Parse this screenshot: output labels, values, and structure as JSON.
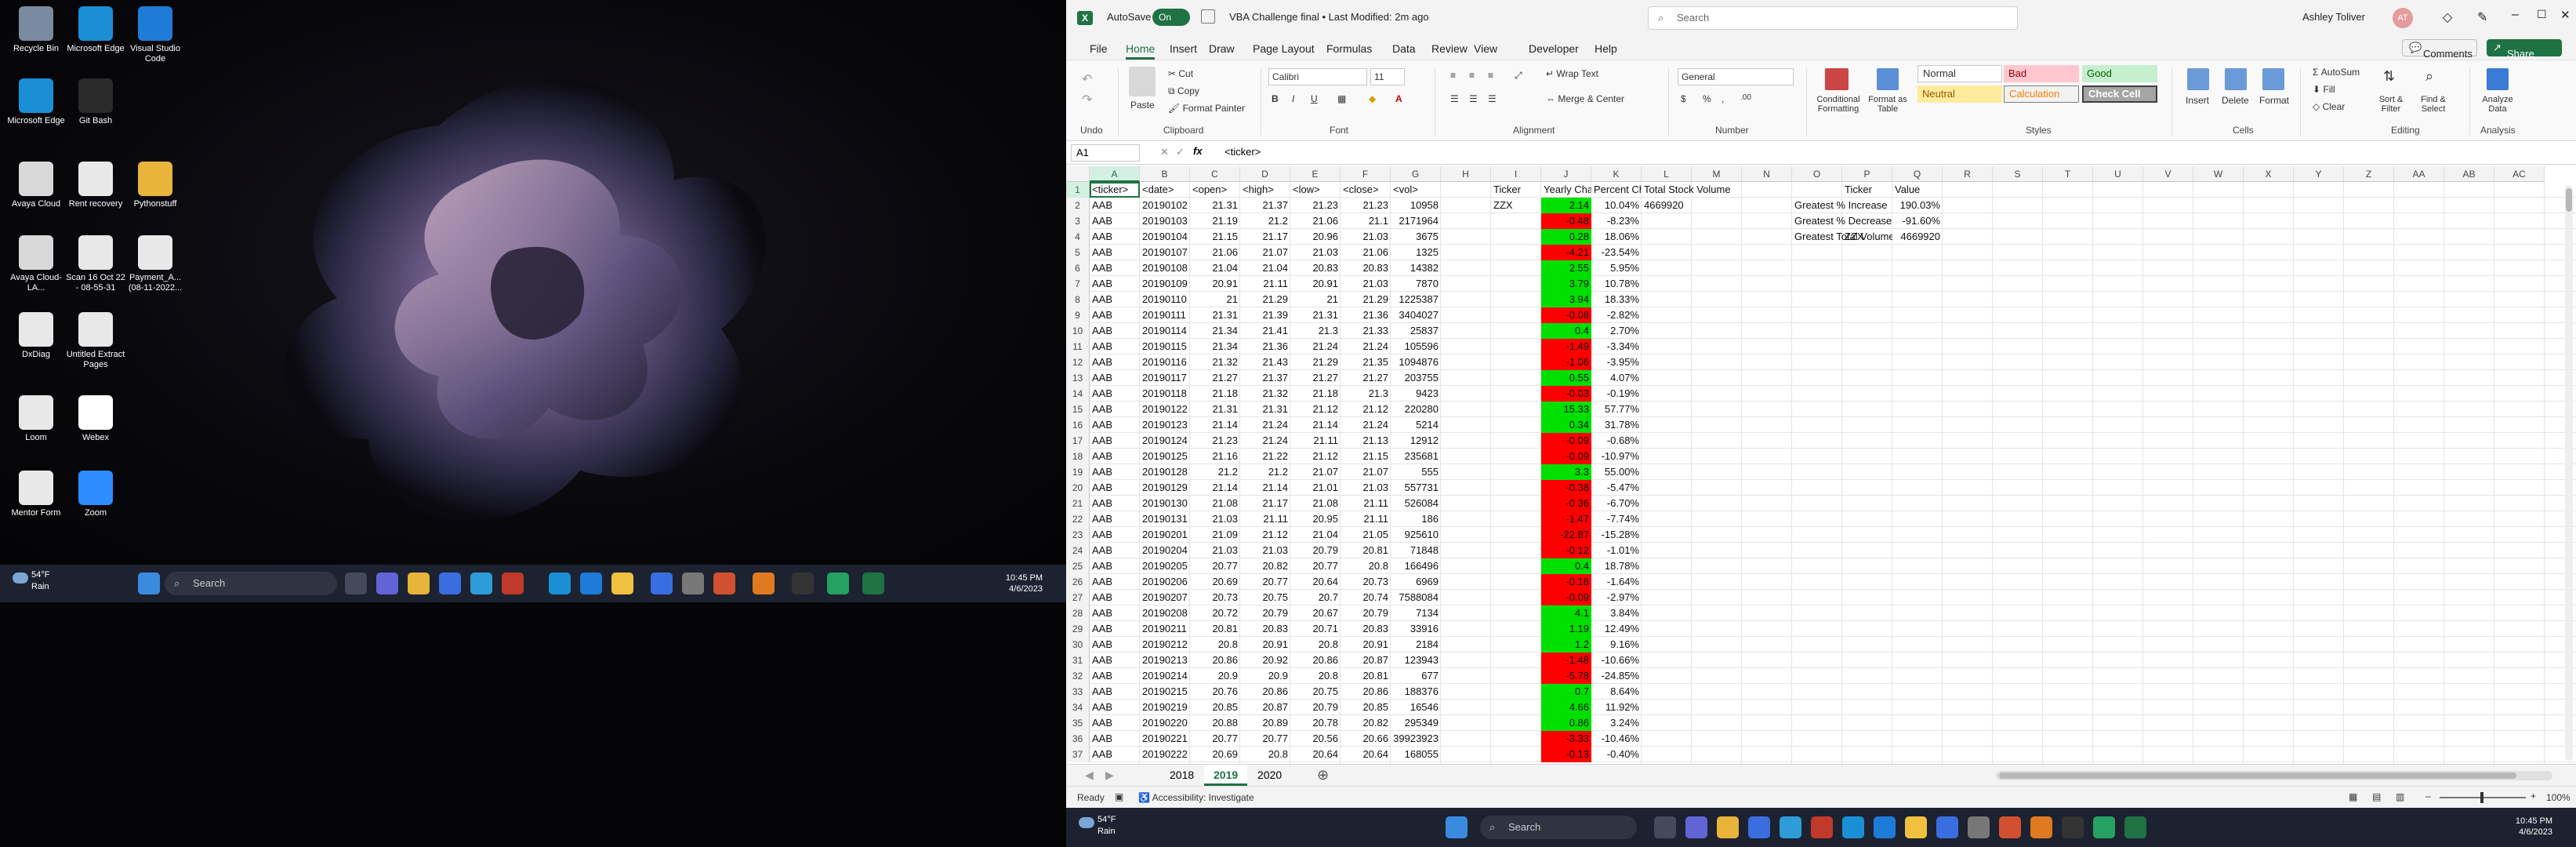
{
  "desktop": {
    "icons": [
      {
        "label": "Recycle Bin",
        "name": "recycle-bin-icon",
        "color": "#7a8aa0"
      },
      {
        "label": "Microsoft Edge",
        "name": "edge-icon",
        "color": "#1a8fd6"
      },
      {
        "label": "Visual Studio Code",
        "name": "vscode-icon",
        "color": "#1f7bd8"
      },
      {
        "label": "Microsoft Edge",
        "name": "edge-icon",
        "color": "#1a8fd6"
      },
      {
        "label": "Git Bash",
        "name": "git-bash-icon",
        "color": "#2a2a2a"
      },
      {
        "label": "Avaya Cloud",
        "name": "avaya-icon",
        "color": "#d9d9d9"
      },
      {
        "label": "Rent recovery",
        "name": "document-icon",
        "color": "#e8e8e8"
      },
      {
        "label": "Pythonstuff",
        "name": "folder-icon",
        "color": "#e8b43a"
      },
      {
        "label": "Avaya Cloud-LA...",
        "name": "avaya-icon",
        "color": "#d9d9d9"
      },
      {
        "label": "Scan 16 Oct 22 - 08-55-31",
        "name": "document-icon",
        "color": "#e8e8e8"
      },
      {
        "label": "Payment_A... (08-11-2022...",
        "name": "document-icon",
        "color": "#e8e8e8"
      },
      {
        "label": "DxDiag",
        "name": "document-icon",
        "color": "#e8e8e8"
      },
      {
        "label": "Untitled Extract Pages",
        "name": "document-icon",
        "color": "#e8e8e8"
      },
      {
        "label": "Loom",
        "name": "loom-icon",
        "color": "#e8e8e8"
      },
      {
        "label": "Webex",
        "name": "document-icon",
        "color": "#ffffff"
      },
      {
        "label": "Mentor Form",
        "name": "document-icon",
        "color": "#e8e8e8"
      },
      {
        "label": "Zoom",
        "name": "zoom-icon",
        "color": "#2d8cff"
      }
    ],
    "taskbar": {
      "weather_temp": "54°F",
      "weather_desc": "Rain",
      "search": "Search",
      "time": "10:45 PM",
      "date": "4/6/2023"
    }
  },
  "excel": {
    "autosave_label": "AutoSave",
    "autosave_state": "On",
    "doc_title": "VBA Challenge final • Last Modified: 2m ago",
    "search_placeholder": "Search",
    "user_name": "Ashley Toliver",
    "user_initials": "AT",
    "menu": [
      "File",
      "Home",
      "Insert",
      "Draw",
      "Page Layout",
      "Formulas",
      "Data",
      "Review",
      "View",
      "Developer",
      "Help"
    ],
    "comments": "Comments",
    "share": "Share",
    "ribbon": {
      "undo": "Undo",
      "paste": "Paste",
      "cut": "Cut",
      "copy": "Copy",
      "format_painter": "Format Painter",
      "clipboard": "Clipboard",
      "font_name": "Calibri",
      "font_size": "11",
      "font": "Font",
      "wrap_text": "Wrap Text",
      "merge_center": "Merge & Center",
      "alignment": "Alignment",
      "number_format": "General",
      "number": "Number",
      "cond_format": "Conditional Formatting",
      "format_table": "Format as Table",
      "styles_label": "Styles",
      "style_normal": "Normal",
      "style_bad": "Bad",
      "style_good": "Good",
      "style_neutral": "Neutral",
      "style_calc": "Calculation",
      "style_check": "Check Cell",
      "insert": "Insert",
      "delete": "Delete",
      "format": "Format",
      "cells": "Cells",
      "autosum": "AutoSum",
      "fill": "Fill",
      "clear": "Clear",
      "sort_filter": "Sort & Filter",
      "find_select": "Find & Select",
      "editing": "Editing",
      "analyze": "Analyze Data",
      "analysis": "Analysis"
    },
    "name_box": "A1",
    "formula": "<ticker>",
    "columns": [
      "A",
      "B",
      "C",
      "D",
      "E",
      "F",
      "G",
      "H",
      "I",
      "J",
      "K",
      "L",
      "M",
      "N",
      "O",
      "P",
      "Q",
      "R",
      "S",
      "T",
      "U",
      "V",
      "W",
      "X",
      "Y",
      "Z",
      "AA",
      "AB",
      "AC"
    ],
    "headers": [
      "<ticker>",
      "<date>",
      "<open>",
      "<high>",
      "<low>",
      "<close>",
      "<vol>"
    ],
    "summary_headers": [
      "Ticker",
      "Yearly Change",
      "Percent Change",
      "Total Stock Volume"
    ],
    "summary_row": {
      "ticker": "ZZX",
      "total": "4669920"
    },
    "greatest": {
      "col_ticker": "Ticker",
      "col_value": "Value",
      "rows": [
        {
          "label": "Greatest % Increase",
          "ticker": "",
          "value": "190.03%"
        },
        {
          "label": "Greatest % Decrease",
          "ticker": "",
          "value": "-91.60%"
        },
        {
          "label": "Greatest Total Volume",
          "ticker": "ZZX",
          "value": "4669920"
        }
      ]
    },
    "rows": [
      [
        "AAB",
        "20190102",
        "21.31",
        "21.37",
        "21.23",
        "21.23",
        "10958",
        "2.14",
        "10.04%"
      ],
      [
        "AAB",
        "20190103",
        "21.19",
        "21.2",
        "21.06",
        "21.1",
        "2171964",
        "-0.48",
        "-8.23%"
      ],
      [
        "AAB",
        "20190104",
        "21.15",
        "21.17",
        "20.96",
        "21.03",
        "3675",
        "0.28",
        "18.06%"
      ],
      [
        "AAB",
        "20190107",
        "21.06",
        "21.07",
        "21.03",
        "21.06",
        "1325",
        "-4.21",
        "-23.54%"
      ],
      [
        "AAB",
        "20190108",
        "21.04",
        "21.04",
        "20.83",
        "20.83",
        "14382",
        "2.55",
        "5.95%"
      ],
      [
        "AAB",
        "20190109",
        "20.91",
        "21.11",
        "20.91",
        "21.03",
        "7870",
        "3.79",
        "10.78%"
      ],
      [
        "AAB",
        "20190110",
        "21",
        "21.29",
        "21",
        "21.29",
        "1225387",
        "3.94",
        "18.33%"
      ],
      [
        "AAB",
        "20190111",
        "21.31",
        "21.39",
        "21.31",
        "21.36",
        "3404027",
        "-0.08",
        "-2.82%"
      ],
      [
        "AAB",
        "20190114",
        "21.34",
        "21.41",
        "21.3",
        "21.33",
        "25837",
        "0.4",
        "2.70%"
      ],
      [
        "AAB",
        "20190115",
        "21.34",
        "21.36",
        "21.24",
        "21.24",
        "105596",
        "-1.49",
        "-3.34%"
      ],
      [
        "AAB",
        "20190116",
        "21.32",
        "21.43",
        "21.29",
        "21.35",
        "1094876",
        "-1.06",
        "-3.95%"
      ],
      [
        "AAB",
        "20190117",
        "21.27",
        "21.37",
        "21.27",
        "21.27",
        "203755",
        "0.55",
        "4.07%"
      ],
      [
        "AAB",
        "20190118",
        "21.18",
        "21.32",
        "21.18",
        "21.3",
        "9423",
        "-0.03",
        "-0.19%"
      ],
      [
        "AAB",
        "20190122",
        "21.31",
        "21.31",
        "21.12",
        "21.12",
        "220280",
        "15.33",
        "57.77%"
      ],
      [
        "AAB",
        "20190123",
        "21.14",
        "21.24",
        "21.14",
        "21.24",
        "5214",
        "0.34",
        "31.78%"
      ],
      [
        "AAB",
        "20190124",
        "21.23",
        "21.24",
        "21.11",
        "21.13",
        "12912",
        "-0.09",
        "-0.68%"
      ],
      [
        "AAB",
        "20190125",
        "21.16",
        "21.22",
        "21.12",
        "21.15",
        "235681",
        "-0.09",
        "-10.97%"
      ],
      [
        "AAB",
        "20190128",
        "21.2",
        "21.2",
        "21.07",
        "21.07",
        "555",
        "3.3",
        "55.00%"
      ],
      [
        "AAB",
        "20190129",
        "21.14",
        "21.14",
        "21.01",
        "21.03",
        "557731",
        "-0.38",
        "-5.47%"
      ],
      [
        "AAB",
        "20190130",
        "21.08",
        "21.17",
        "21.08",
        "21.11",
        "526084",
        "-0.36",
        "-6.70%"
      ],
      [
        "AAB",
        "20190131",
        "21.03",
        "21.11",
        "20.95",
        "21.11",
        "186",
        "-1.47",
        "-7.74%"
      ],
      [
        "AAB",
        "20190201",
        "21.09",
        "21.12",
        "21.04",
        "21.05",
        "925610",
        "-22.87",
        "-15.28%"
      ],
      [
        "AAB",
        "20190204",
        "21.03",
        "21.03",
        "20.79",
        "20.81",
        "71848",
        "-0.12",
        "-1.01%"
      ],
      [
        "AAB",
        "20190205",
        "20.77",
        "20.82",
        "20.77",
        "20.8",
        "166496",
        "0.4",
        "18.78%"
      ],
      [
        "AAB",
        "20190206",
        "20.69",
        "20.77",
        "20.64",
        "20.73",
        "6969",
        "-0.18",
        "-1.64%"
      ],
      [
        "AAB",
        "20190207",
        "20.73",
        "20.75",
        "20.7",
        "20.74",
        "7588084",
        "-0.09",
        "-2.97%"
      ],
      [
        "AAB",
        "20190208",
        "20.72",
        "20.79",
        "20.67",
        "20.79",
        "7134",
        "4.1",
        "3.84%"
      ],
      [
        "AAB",
        "20190211",
        "20.81",
        "20.83",
        "20.71",
        "20.83",
        "33916",
        "1.19",
        "12.49%"
      ],
      [
        "AAB",
        "20190212",
        "20.8",
        "20.91",
        "20.8",
        "20.91",
        "2184",
        "1.2",
        "9.16%"
      ],
      [
        "AAB",
        "20190213",
        "20.86",
        "20.92",
        "20.86",
        "20.87",
        "123943",
        "-1.48",
        "-10.66%"
      ],
      [
        "AAB",
        "20190214",
        "20.9",
        "20.9",
        "20.8",
        "20.81",
        "677",
        "-5.78",
        "-24.85%"
      ],
      [
        "AAB",
        "20190215",
        "20.76",
        "20.86",
        "20.75",
        "20.86",
        "188376",
        "0.7",
        "8.64%"
      ],
      [
        "AAB",
        "20190219",
        "20.85",
        "20.87",
        "20.79",
        "20.85",
        "16546",
        "4.66",
        "11.92%"
      ],
      [
        "AAB",
        "20190220",
        "20.88",
        "20.89",
        "20.78",
        "20.82",
        "295349",
        "0.86",
        "3.24%"
      ],
      [
        "AAB",
        "20190221",
        "20.77",
        "20.77",
        "20.56",
        "20.66",
        "39923923",
        "-3.33",
        "-10.46%"
      ],
      [
        "AAB",
        "20190222",
        "20.69",
        "20.8",
        "20.64",
        "20.64",
        "168055",
        "-0.13",
        "-0.40%"
      ]
    ],
    "sheet_tabs": [
      "2018",
      "2019",
      "2020"
    ],
    "active_tab": "2019",
    "status_ready": "Ready",
    "accessibility": "Accessibility: Investigate",
    "zoom": "100%",
    "colors": {
      "green": "#00e000",
      "red": "#ff0000",
      "excel": "#1f7244"
    }
  },
  "taskbar2": {
    "weather_temp": "54°F",
    "weather_desc": "Rain",
    "search": "Search",
    "time": "10:45 PM",
    "date": "4/6/2023"
  }
}
